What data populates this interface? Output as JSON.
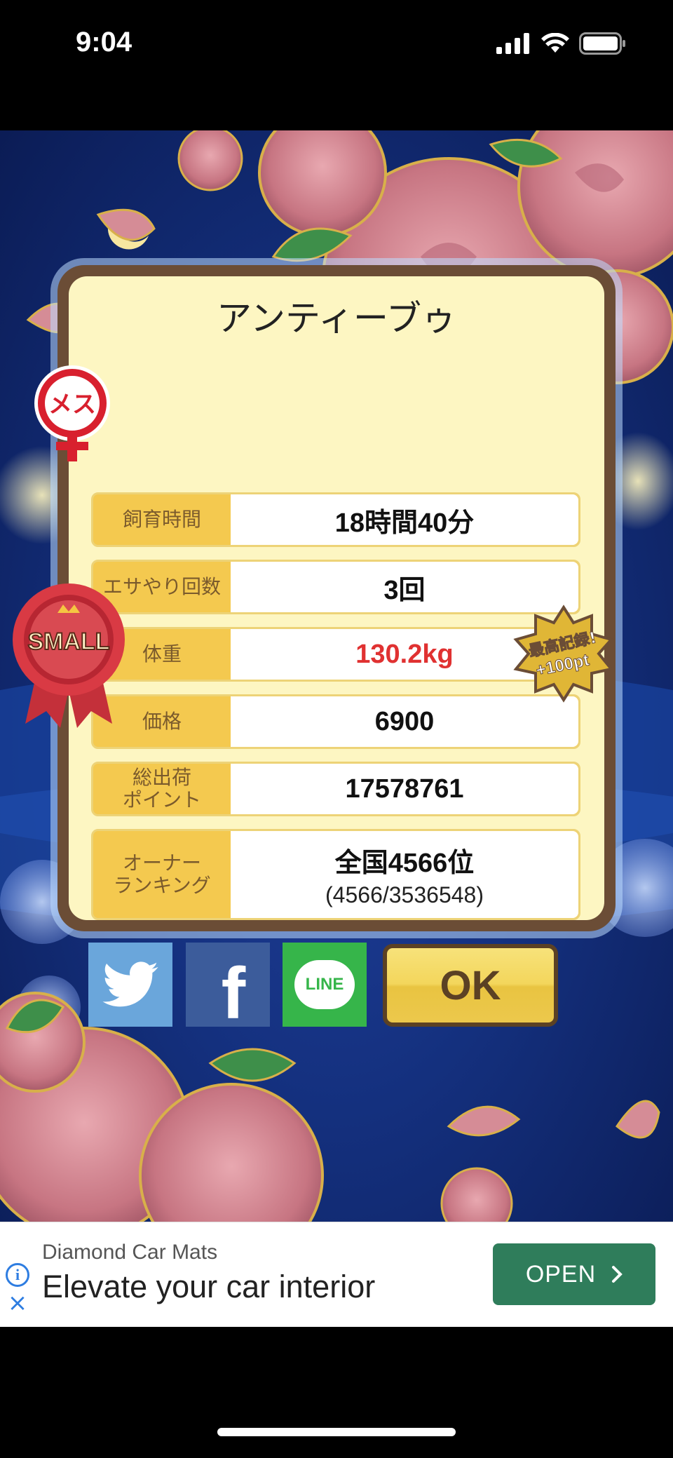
{
  "status_bar": {
    "time": "9:04"
  },
  "pet": {
    "name": "アンティーブゥ",
    "gender_badge": "メス",
    "size_badge": "SMALL",
    "record_badge_line1": "最高記録!",
    "record_badge_line2": "+100pt"
  },
  "stats": [
    {
      "label": "飼育時間",
      "value": "18時間40分"
    },
    {
      "label": "エサやり回数",
      "value": "3回"
    },
    {
      "label": "体重",
      "value": "130.2kg"
    },
    {
      "label": "価格",
      "value": "6900"
    },
    {
      "label": "総出荷\nポイント",
      "value": "17578761"
    },
    {
      "label": "オーナー\nランキング",
      "value": "全国4566位",
      "sub": "(4566/3536548)"
    }
  ],
  "share": {
    "twitter": "twitter-icon",
    "facebook": "f",
    "line": "LINE"
  },
  "ok_label": "OK",
  "ad": {
    "title": "Diamond Car Mats",
    "subtitle": "Elevate your car interior",
    "cta": "OPEN"
  },
  "colors": {
    "accent_yellow": "#f4c94f",
    "card_bg": "#fdf6c2",
    "frame_brown": "#6b4d36",
    "weight_red": "#e03131",
    "ad_green": "#2f7d5b"
  }
}
